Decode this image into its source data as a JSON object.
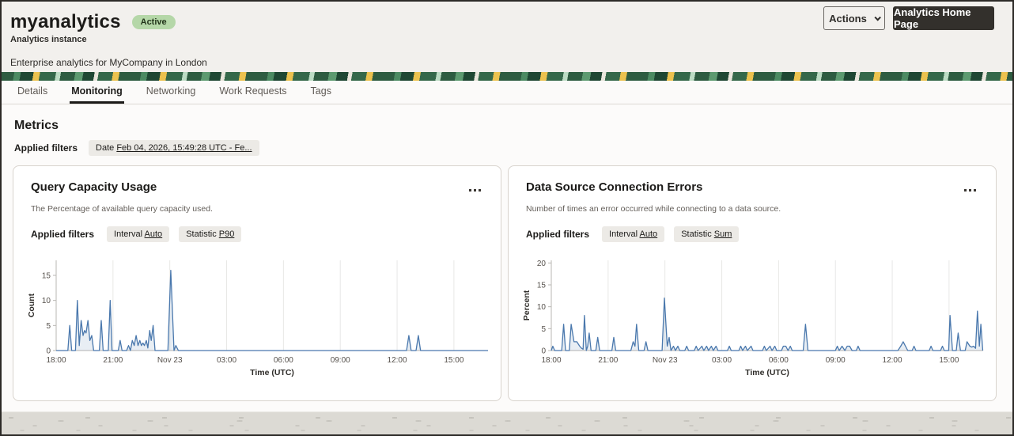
{
  "header": {
    "title": "myanalytics",
    "status": "Active",
    "type_label": "Analytics instance",
    "description": "Enterprise analytics for MyCompany in London",
    "actions_button": "Actions",
    "home_button": "Analytics Home Page"
  },
  "tabs": [
    {
      "label": "Details"
    },
    {
      "label": "Monitoring"
    },
    {
      "label": "Networking"
    },
    {
      "label": "Work Requests"
    },
    {
      "label": "Tags"
    }
  ],
  "active_tab": "Monitoring",
  "metrics": {
    "heading": "Metrics",
    "applied_filters_label": "Applied filters",
    "date_filter": {
      "label": "Date",
      "value": "Feb 04, 2026, 15:49:28 UTC - Fe..."
    }
  },
  "cards": [
    {
      "title": "Query Capacity Usage",
      "menu_icon": "overflow-menu-icon",
      "description": "The Percentage of available query capacity used.",
      "applied_filters_label": "Applied filters",
      "filters": [
        {
          "label": "Interval",
          "value": "Auto"
        },
        {
          "label": "Statistic",
          "value": "P90"
        }
      ]
    },
    {
      "title": "Data Source Connection Errors",
      "menu_icon": "overflow-menu-icon",
      "description": "Number of times an error occurred while connecting to a data source.",
      "applied_filters_label": "Applied filters",
      "filters": [
        {
          "label": "Interval",
          "value": "Auto"
        },
        {
          "label": "Statistic",
          "value": "Sum"
        }
      ]
    }
  ],
  "chart_data": [
    {
      "type": "line",
      "title": "Query Capacity Usage",
      "xlabel": "Time (UTC)",
      "ylabel": "Count",
      "legend": "none",
      "grid": "vertical",
      "xlim": [
        0,
        22.8
      ],
      "ylim": [
        0,
        18
      ],
      "y_ticks": [
        0,
        5,
        10,
        15
      ],
      "x_ticks": [
        {
          "t": 0,
          "label": "18:00"
        },
        {
          "t": 3,
          "label": "21:00"
        },
        {
          "t": 6,
          "label": "Nov 23"
        },
        {
          "t": 9,
          "label": "03:00"
        },
        {
          "t": 12,
          "label": "06:00"
        },
        {
          "t": 15,
          "label": "09:00"
        },
        {
          "t": 18,
          "label": "12:00"
        },
        {
          "t": 21,
          "label": "15:00"
        }
      ],
      "line_color": "#4a78ad",
      "fill_color": "rgba(74,120,173,0.13)",
      "points": [
        [
          0,
          0
        ],
        [
          0.62,
          0
        ],
        [
          0.72,
          5
        ],
        [
          0.82,
          0
        ],
        [
          1.02,
          0
        ],
        [
          1.12,
          10
        ],
        [
          1.22,
          1
        ],
        [
          1.32,
          6
        ],
        [
          1.42,
          3
        ],
        [
          1.5,
          4
        ],
        [
          1.58,
          3.5
        ],
        [
          1.68,
          6
        ],
        [
          1.78,
          2
        ],
        [
          1.88,
          3
        ],
        [
          1.98,
          0
        ],
        [
          2.28,
          0
        ],
        [
          2.38,
          6
        ],
        [
          2.48,
          0
        ],
        [
          2.75,
          0
        ],
        [
          2.85,
          10
        ],
        [
          2.95,
          0
        ],
        [
          3.28,
          0
        ],
        [
          3.38,
          2
        ],
        [
          3.48,
          0
        ],
        [
          3.72,
          0
        ],
        [
          3.82,
          1
        ],
        [
          3.92,
          0
        ],
        [
          4.02,
          2
        ],
        [
          4.12,
          1
        ],
        [
          4.22,
          3
        ],
        [
          4.32,
          1
        ],
        [
          4.42,
          2
        ],
        [
          4.5,
          1
        ],
        [
          4.58,
          1.5
        ],
        [
          4.66,
          1
        ],
        [
          4.76,
          2
        ],
        [
          4.84,
          0.5
        ],
        [
          4.94,
          4
        ],
        [
          5.02,
          2
        ],
        [
          5.12,
          5
        ],
        [
          5.22,
          0
        ],
        [
          5.9,
          0
        ],
        [
          6.05,
          16
        ],
        [
          6.22,
          0
        ],
        [
          6.32,
          1
        ],
        [
          6.45,
          0
        ],
        [
          18.5,
          0
        ],
        [
          18.62,
          3
        ],
        [
          18.74,
          0
        ],
        [
          19.0,
          0
        ],
        [
          19.12,
          3
        ],
        [
          19.24,
          0
        ],
        [
          22.8,
          0
        ]
      ]
    },
    {
      "type": "line",
      "title": "Data Source Connection Errors",
      "xlabel": "Time (UTC)",
      "ylabel": "Percent",
      "legend": "none",
      "grid": "vertical",
      "xlim": [
        0,
        22.8
      ],
      "ylim": [
        0,
        20.6
      ],
      "y_ticks": [
        0,
        5,
        10,
        15,
        20
      ],
      "x_ticks": [
        {
          "t": 0,
          "label": "18:00"
        },
        {
          "t": 3,
          "label": "21:00"
        },
        {
          "t": 6,
          "label": "Nov 23"
        },
        {
          "t": 9,
          "label": "03:00"
        },
        {
          "t": 12,
          "label": "06:00"
        },
        {
          "t": 15,
          "label": "09:00"
        },
        {
          "t": 18,
          "label": "12:00"
        },
        {
          "t": 21,
          "label": "15:00"
        }
      ],
      "line_color": "#4a78ad",
      "fill_color": "rgba(74,120,173,0.13)",
      "points": [
        [
          0,
          0
        ],
        [
          0.08,
          1
        ],
        [
          0.18,
          0
        ],
        [
          0.55,
          0
        ],
        [
          0.65,
          6
        ],
        [
          0.75,
          0
        ],
        [
          0.95,
          0
        ],
        [
          1.05,
          6
        ],
        [
          1.2,
          2
        ],
        [
          1.35,
          2
        ],
        [
          1.5,
          1
        ],
        [
          1.6,
          0.5
        ],
        [
          1.68,
          0.3
        ],
        [
          1.75,
          8
        ],
        [
          1.85,
          0
        ],
        [
          1.92,
          1
        ],
        [
          2.0,
          4
        ],
        [
          2.1,
          0
        ],
        [
          2.35,
          0
        ],
        [
          2.45,
          3
        ],
        [
          2.55,
          0
        ],
        [
          3.2,
          0
        ],
        [
          3.3,
          3
        ],
        [
          3.4,
          0
        ],
        [
          4.2,
          0
        ],
        [
          4.32,
          2
        ],
        [
          4.42,
          1
        ],
        [
          4.5,
          6
        ],
        [
          4.62,
          0
        ],
        [
          4.9,
          0
        ],
        [
          5.0,
          2
        ],
        [
          5.1,
          0
        ],
        [
          5.85,
          0
        ],
        [
          5.97,
          12
        ],
        [
          6.12,
          1
        ],
        [
          6.22,
          3
        ],
        [
          6.32,
          0
        ],
        [
          6.45,
          1
        ],
        [
          6.55,
          0
        ],
        [
          6.68,
          1
        ],
        [
          6.78,
          0
        ],
        [
          7.05,
          0
        ],
        [
          7.15,
          1
        ],
        [
          7.25,
          0
        ],
        [
          7.55,
          0
        ],
        [
          7.65,
          1
        ],
        [
          7.75,
          0
        ],
        [
          7.95,
          1
        ],
        [
          8.05,
          0
        ],
        [
          8.2,
          1
        ],
        [
          8.3,
          0
        ],
        [
          8.45,
          1
        ],
        [
          8.55,
          0
        ],
        [
          8.7,
          1
        ],
        [
          8.8,
          0
        ],
        [
          9.3,
          0
        ],
        [
          9.4,
          1
        ],
        [
          9.5,
          0
        ],
        [
          9.9,
          0
        ],
        [
          10.0,
          1
        ],
        [
          10.1,
          0
        ],
        [
          10.25,
          1
        ],
        [
          10.35,
          0
        ],
        [
          10.55,
          1
        ],
        [
          10.65,
          0
        ],
        [
          11.15,
          0
        ],
        [
          11.25,
          1
        ],
        [
          11.35,
          0
        ],
        [
          11.55,
          1
        ],
        [
          11.65,
          0
        ],
        [
          11.8,
          1
        ],
        [
          11.9,
          0
        ],
        [
          12.15,
          0
        ],
        [
          12.25,
          1
        ],
        [
          12.38,
          1
        ],
        [
          12.5,
          0
        ],
        [
          12.62,
          1
        ],
        [
          12.72,
          0
        ],
        [
          13.3,
          0
        ],
        [
          13.42,
          6
        ],
        [
          13.55,
          0
        ],
        [
          15.0,
          0
        ],
        [
          15.1,
          1
        ],
        [
          15.2,
          0
        ],
        [
          15.35,
          1
        ],
        [
          15.5,
          0
        ],
        [
          15.62,
          1
        ],
        [
          15.75,
          1
        ],
        [
          15.88,
          0
        ],
        [
          16.1,
          0
        ],
        [
          16.2,
          1
        ],
        [
          16.3,
          0
        ],
        [
          18.3,
          0
        ],
        [
          18.45,
          1
        ],
        [
          18.58,
          2
        ],
        [
          18.7,
          1
        ],
        [
          18.82,
          0
        ],
        [
          19.05,
          0
        ],
        [
          19.15,
          1
        ],
        [
          19.25,
          0
        ],
        [
          19.95,
          0
        ],
        [
          20.05,
          1
        ],
        [
          20.15,
          0
        ],
        [
          20.55,
          0
        ],
        [
          20.65,
          1
        ],
        [
          20.75,
          0
        ],
        [
          20.98,
          0
        ],
        [
          21.05,
          8
        ],
        [
          21.18,
          0
        ],
        [
          21.38,
          0
        ],
        [
          21.48,
          4
        ],
        [
          21.6,
          0
        ],
        [
          21.85,
          0
        ],
        [
          21.95,
          2
        ],
        [
          22.1,
          1
        ],
        [
          22.2,
          0.8
        ],
        [
          22.3,
          1
        ],
        [
          22.4,
          0.5
        ],
        [
          22.5,
          9
        ],
        [
          22.6,
          1
        ],
        [
          22.68,
          6
        ],
        [
          22.78,
          0
        ]
      ]
    }
  ],
  "colors": {
    "line": "#4a78ad",
    "status_badge_bg": "#b5d7a8",
    "dark_button_bg": "#33302c",
    "banner_greens": [
      "#1f4733",
      "#2e5c41",
      "#4c8a62",
      "#bcdcc4"
    ],
    "banner_yellow": "#ecc24f",
    "header_bg": "#f2f0ed"
  }
}
